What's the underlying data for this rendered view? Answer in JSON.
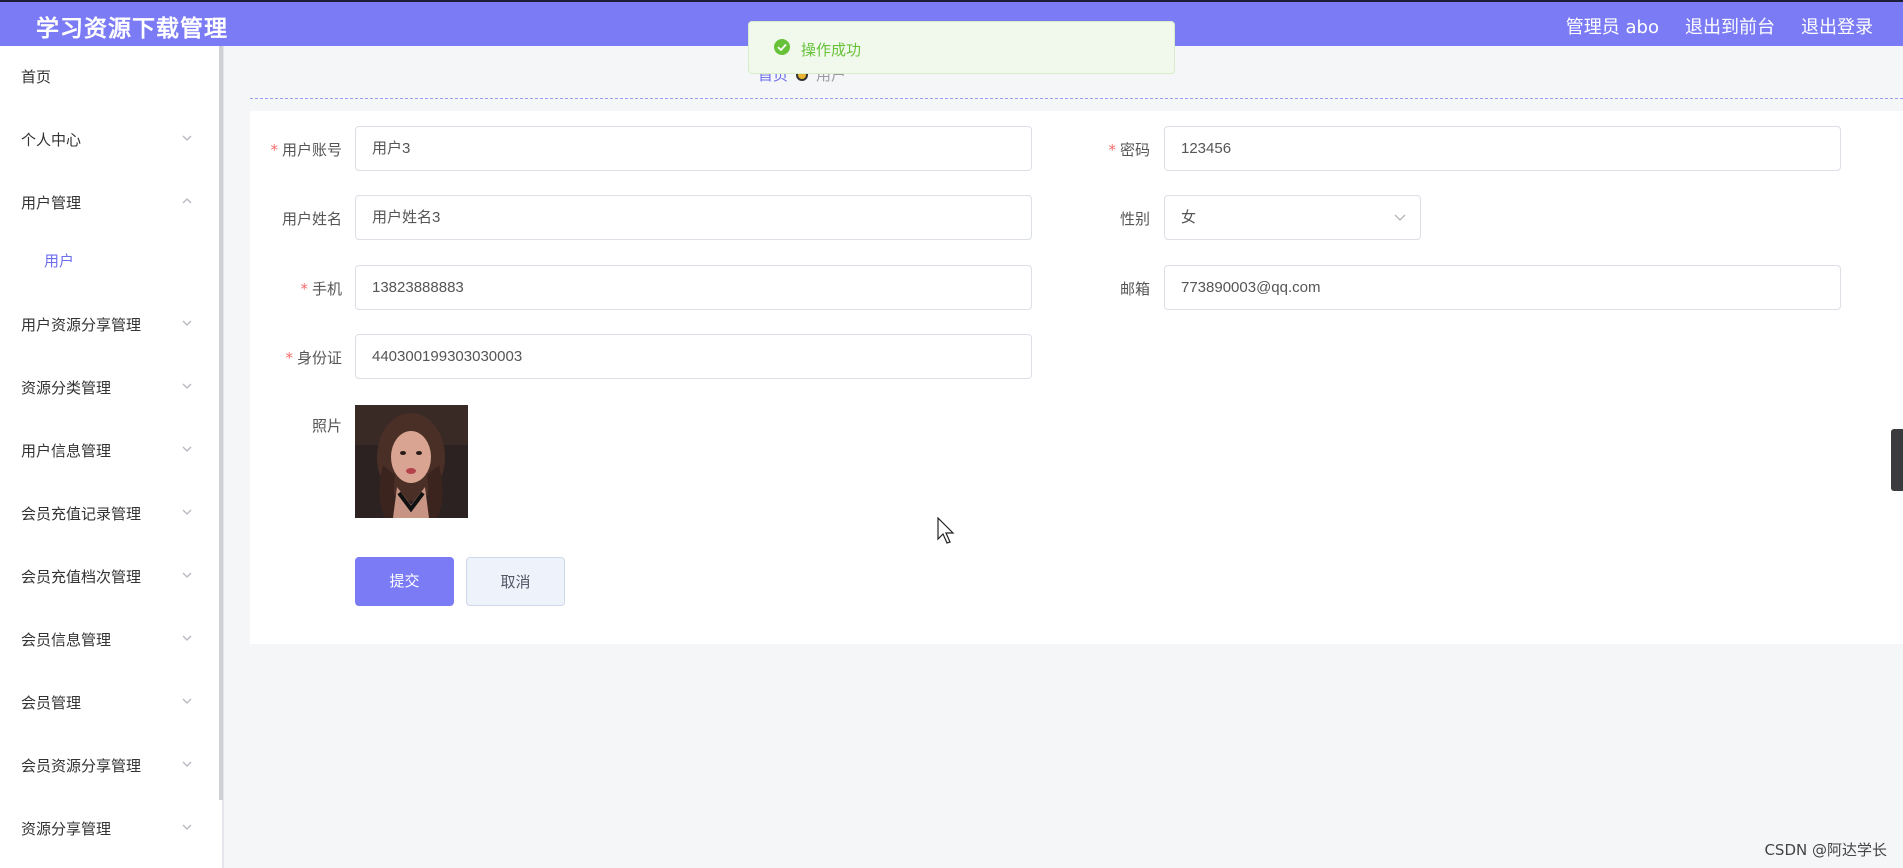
{
  "header": {
    "title": "学习资源下载管理",
    "admin_label": "管理员 abo",
    "to_frontend": "退出到前台",
    "logout": "退出登录"
  },
  "sidebar": {
    "items": [
      {
        "label": "首页"
      },
      {
        "label": "个人中心"
      },
      {
        "label": "用户管理"
      },
      {
        "label": "用户"
      },
      {
        "label": "用户资源分享管理"
      },
      {
        "label": "资源分类管理"
      },
      {
        "label": "用户信息管理"
      },
      {
        "label": "会员充值记录管理"
      },
      {
        "label": "会员充值档次管理"
      },
      {
        "label": "会员信息管理"
      },
      {
        "label": "会员管理"
      },
      {
        "label": "会员资源分享管理"
      },
      {
        "label": "资源分享管理"
      }
    ]
  },
  "breadcrumb": {
    "home": "首页",
    "current": "用户"
  },
  "toast": {
    "message": "操作成功"
  },
  "form": {
    "username_label": "用户账号",
    "username_value": "用户3",
    "password_label": "密码",
    "password_value": "123456",
    "name_label": "用户姓名",
    "name_value": "用户姓名3",
    "gender_label": "性别",
    "gender_value": "女",
    "phone_label": "手机",
    "phone_value": "13823888883",
    "email_label": "邮箱",
    "email_value": "773890003@qq.com",
    "id_label": "身份证",
    "id_value": "440300199303030003",
    "photo_label": "照片",
    "required_mark": "*",
    "submit_label": "提交",
    "cancel_label": "取消"
  },
  "watermark": "CSDN @阿达学长",
  "colors": {
    "accent": "#7b7bf5",
    "success": "#67c23a",
    "required": "#f56c6c"
  }
}
